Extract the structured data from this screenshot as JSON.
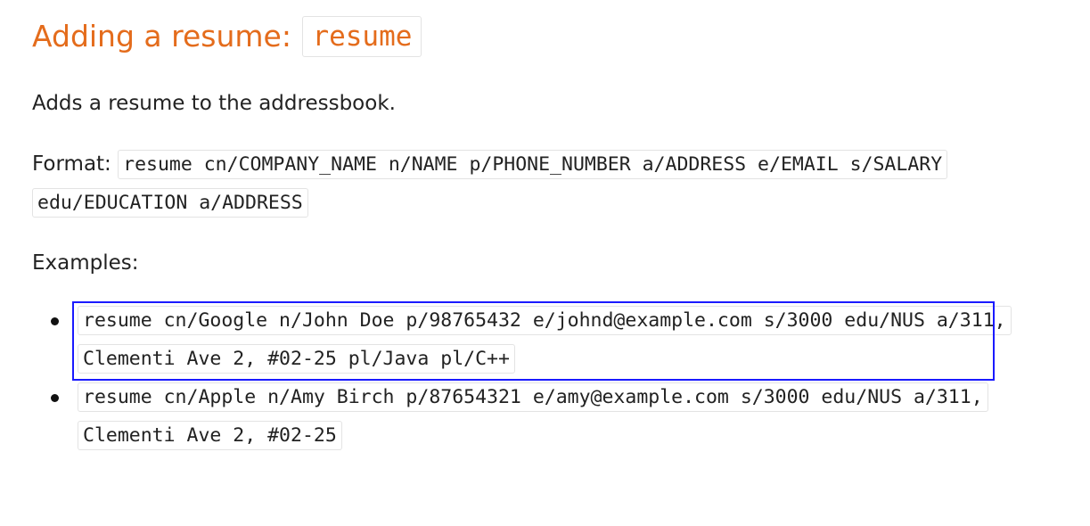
{
  "section": {
    "title_prefix": "Adding a resume: ",
    "title_code": "resume",
    "description": "Adds a resume to the addressbook.",
    "format_label": "Format: ",
    "format_code": "resume cn/COMPANY_NAME n/NAME p/PHONE_NUMBER a/ADDRESS e/EMAIL s/SALARY edu/EDUCATION a/ADDRESS",
    "examples_label": "Examples:",
    "examples": [
      "resume cn/Google n/John Doe p/98765432 e/johnd@example.com s/3000 edu/NUS a/311, Clementi Ave 2, #02-25 pl/Java pl/C++",
      "resume cn/Apple n/Amy Birch p/87654321 e/amy@example.com s/3000 edu/NUS a/311, Clementi Ave 2, #02-25"
    ]
  },
  "colors": {
    "heading": "#e46c1c",
    "text": "#222222",
    "code_border": "#e3e3e3",
    "highlight_box": "#1a1aff"
  }
}
